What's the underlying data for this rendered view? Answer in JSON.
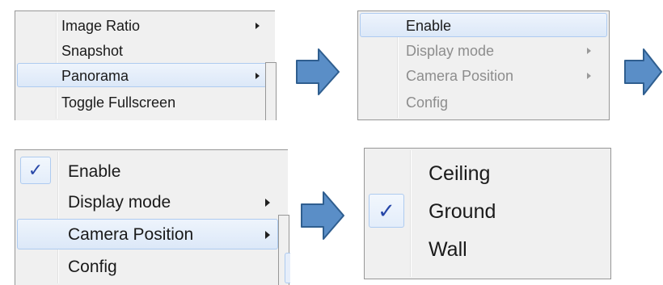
{
  "colors": {
    "arrow_fill": "#5a8ec7",
    "arrow_stroke": "#2f5e8f",
    "highlight": "#dce8f8",
    "check": "#2747a8"
  },
  "panel1": {
    "items": [
      {
        "label": "Image Ratio",
        "submenu": true,
        "state": "normal"
      },
      {
        "label": "Snapshot",
        "submenu": false,
        "state": "normal"
      },
      {
        "label": "Panorama",
        "submenu": true,
        "state": "highlighted"
      },
      {
        "label": "Toggle Fullscreen",
        "submenu": false,
        "state": "normal"
      }
    ]
  },
  "panel2": {
    "items": [
      {
        "label": "Enable",
        "submenu": false,
        "state": "highlighted"
      },
      {
        "label": "Display mode",
        "submenu": true,
        "state": "disabled"
      },
      {
        "label": "Camera Position",
        "submenu": true,
        "state": "disabled"
      },
      {
        "label": "Config",
        "submenu": false,
        "state": "disabled"
      }
    ]
  },
  "panel3": {
    "items": [
      {
        "label": "Enable",
        "submenu": false,
        "checked": true,
        "check_glyph": "✓"
      },
      {
        "label": "Display mode",
        "submenu": true
      },
      {
        "label": "Camera Position",
        "submenu": true,
        "state": "highlighted"
      },
      {
        "label": "Config",
        "submenu": false
      }
    ]
  },
  "panel4": {
    "items": [
      {
        "label": "Ceiling",
        "checked": false
      },
      {
        "label": "Ground",
        "checked": true,
        "check_glyph": "✓"
      },
      {
        "label": "Wall",
        "checked": false
      }
    ]
  },
  "icons": {
    "flow_arrow": "right-arrow-icon",
    "submenu_arrow": "submenu-triangle-icon",
    "check": "checkmark-icon"
  }
}
